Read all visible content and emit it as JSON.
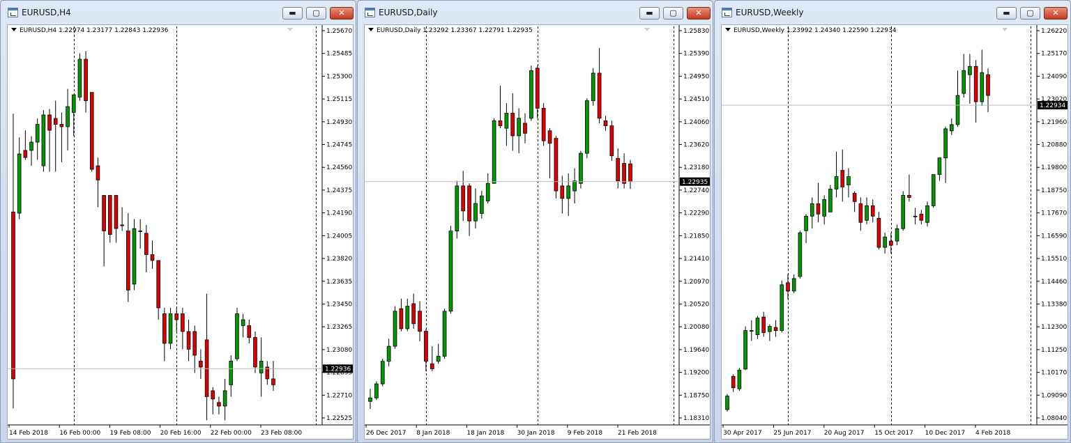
{
  "windows": [
    {
      "id": "h4",
      "title": "EURUSD,H4",
      "info": "EURUSD,H4  1.22974 1.23177 1.22843 1.22936",
      "current_price": "1.22936",
      "current_value": 1.22936,
      "y_min": 1.2252,
      "y_max": 1.2578,
      "price_ticks": [
        "1.25670",
        "1.25485",
        "1.25300",
        "1.25115",
        "1.24930",
        "1.24745",
        "1.24560",
        "1.24375",
        "1.24190",
        "1.24005",
        "1.23820",
        "1.23635",
        "1.23450",
        "1.23265",
        "1.23080",
        "1.22895",
        "1.22710",
        "1.22525"
      ],
      "date_labels": [
        "14 Feb 2018",
        "16 Feb 00:00",
        "19 Feb 08:00",
        "20 Feb 16:00",
        "22 Feb 00:00",
        "23 Feb 08:00"
      ],
      "candles": [
        [
          1.2426,
          1.2509,
          1.226,
          1.2285
        ],
        [
          1.2425,
          1.2489,
          1.242,
          1.2475
        ],
        [
          1.2478,
          1.2495,
          1.247,
          1.2472
        ],
        [
          1.2478,
          1.249,
          1.2465,
          1.2485
        ],
        [
          1.2485,
          1.2505,
          1.247,
          1.25
        ],
        [
          1.2465,
          1.2512,
          1.246,
          1.2508
        ],
        [
          1.2508,
          1.2513,
          1.246,
          1.2495
        ],
        [
          1.2505,
          1.252,
          1.246,
          1.25
        ],
        [
          1.25,
          1.251,
          1.2468,
          1.2498
        ],
        [
          1.2498,
          1.253,
          1.2478,
          1.2515
        ],
        [
          1.251,
          1.2525,
          1.249,
          1.2525
        ],
        [
          1.2523,
          1.256,
          1.252,
          1.2555
        ],
        [
          1.2555,
          1.2562,
          1.251,
          1.252
        ],
        [
          1.2527,
          1.2527,
          1.246,
          1.2462
        ],
        [
          1.2465,
          1.2472,
          1.243,
          1.2453
        ],
        [
          1.244,
          1.244,
          1.238,
          1.241
        ],
        [
          1.244,
          1.244,
          1.24,
          1.2407
        ],
        [
          1.244,
          1.244,
          1.24,
          1.2412
        ],
        [
          1.2415,
          1.243,
          1.241,
          1.2415
        ],
        [
          1.241,
          1.2425,
          1.235,
          1.236
        ],
        [
          1.2365,
          1.242,
          1.236,
          1.2412
        ],
        [
          1.241,
          1.242,
          1.2395,
          1.241
        ],
        [
          1.2408,
          1.2415,
          1.2375,
          1.239
        ],
        [
          1.239,
          1.2402,
          1.2378,
          1.2385
        ],
        [
          1.2385,
          1.2385,
          1.2335,
          1.2345
        ],
        [
          1.234,
          1.2345,
          1.23,
          1.2315
        ],
        [
          1.2315,
          1.2345,
          1.231,
          1.234
        ],
        [
          1.234,
          1.2345,
          1.2325,
          1.2335
        ],
        [
          1.234,
          1.2345,
          1.231,
          1.2325
        ],
        [
          1.2325,
          1.2335,
          1.23,
          1.231
        ],
        [
          1.2325,
          1.233,
          1.229,
          1.2305
        ],
        [
          1.23,
          1.231,
          1.2285,
          1.2295
        ],
        [
          1.2318,
          1.2357,
          1.225,
          1.227
        ],
        [
          1.2275,
          1.2278,
          1.2255,
          1.2268
        ],
        [
          1.2265,
          1.227,
          1.2255,
          1.2262
        ],
        [
          1.2262,
          1.2285,
          1.225,
          1.2275
        ],
        [
          1.228,
          1.2305,
          1.227,
          1.23
        ],
        [
          1.2302,
          1.2345,
          1.23,
          1.234
        ],
        [
          1.233,
          1.234,
          1.232,
          1.2335
        ],
        [
          1.233,
          1.2335,
          1.2315,
          1.232
        ],
        [
          1.232,
          1.2325,
          1.229,
          1.2295
        ],
        [
          1.229,
          1.232,
          1.227,
          1.23
        ],
        [
          1.2295,
          1.23,
          1.228,
          1.2285
        ],
        [
          1.2285,
          1.23,
          1.2275,
          1.228
        ]
      ]
    },
    {
      "id": "d1",
      "title": "EURUSD,Daily",
      "info": "EURUSD,Daily  1.23292 1.23367 1.22791 1.22935",
      "current_price": "1.22935",
      "current_value": 1.22935,
      "y_min": 1.1822,
      "y_max": 1.2592,
      "price_ticks": [
        "1.25830",
        "1.25390",
        "1.24950",
        "1.24510",
        "1.24060",
        "1.23620",
        "1.23180",
        "1.22740",
        "1.22290",
        "1.21850",
        "1.21410",
        "1.20970",
        "1.20520",
        "1.20080",
        "1.19640",
        "1.19200",
        "1.18750",
        "1.18310"
      ],
      "date_labels": [
        "26 Dec 2017",
        "8 Jan 2018",
        "18 Jan 2018",
        "30 Jan 2018",
        "9 Feb 2018",
        "21 Feb 2018"
      ],
      "candles": [
        [
          1.1855,
          1.188,
          1.184,
          1.1862
        ],
        [
          1.1862,
          1.1895,
          1.1858,
          1.189
        ],
        [
          1.189,
          1.194,
          1.1885,
          1.1935
        ],
        [
          1.1935,
          1.198,
          1.1925,
          1.1965
        ],
        [
          1.1965,
          1.2045,
          1.196,
          1.2035
        ],
        [
          1.204,
          1.206,
          1.1995,
          1.2
        ],
        [
          1.2,
          1.206,
          1.1995,
          1.2045
        ],
        [
          1.205,
          1.207,
          1.2,
          1.201
        ],
        [
          1.2035,
          1.2055,
          1.1975,
          1.1995
        ],
        [
          1.1995,
          1.2,
          1.1915,
          1.1935
        ],
        [
          1.193,
          1.1965,
          1.1915,
          1.192
        ],
        [
          1.1935,
          1.197,
          1.193,
          1.1945
        ],
        [
          1.1945,
          1.204,
          1.194,
          1.2035
        ],
        [
          1.2035,
          1.2205,
          1.203,
          1.2195
        ],
        [
          1.2195,
          1.2295,
          1.218,
          1.2285
        ],
        [
          1.2285,
          1.2315,
          1.2215,
          1.2235
        ],
        [
          1.2285,
          1.229,
          1.2185,
          1.2215
        ],
        [
          1.2215,
          1.228,
          1.22,
          1.225
        ],
        [
          1.223,
          1.2275,
          1.222,
          1.2265
        ],
        [
          1.2255,
          1.231,
          1.225,
          1.229
        ],
        [
          1.229,
          1.242,
          1.229,
          1.2415
        ],
        [
          1.2415,
          1.2485,
          1.24,
          1.2405
        ],
        [
          1.24,
          1.245,
          1.2365,
          1.243
        ],
        [
          1.243,
          1.247,
          1.2355,
          1.2385
        ],
        [
          1.2385,
          1.244,
          1.235,
          1.242
        ],
        [
          1.241,
          1.243,
          1.237,
          1.239
        ],
        [
          1.242,
          1.2525,
          1.2415,
          1.2515
        ],
        [
          1.252,
          1.2525,
          1.242,
          1.244
        ],
        [
          1.244,
          1.245,
          1.2365,
          1.2375
        ],
        [
          1.2395,
          1.24,
          1.23,
          1.237
        ],
        [
          1.238,
          1.2385,
          1.226,
          1.2275
        ],
        [
          1.2285,
          1.2305,
          1.223,
          1.226
        ],
        [
          1.226,
          1.231,
          1.2225,
          1.2285
        ],
        [
          1.2275,
          1.232,
          1.225,
          1.2295
        ],
        [
          1.229,
          1.2355,
          1.228,
          1.235
        ],
        [
          1.235,
          1.246,
          1.234,
          1.2455
        ],
        [
          1.2455,
          1.252,
          1.2445,
          1.251
        ],
        [
          1.251,
          1.256,
          1.241,
          1.242
        ],
        [
          1.2415,
          1.2425,
          1.2395,
          1.2405
        ],
        [
          1.2405,
          1.2415,
          1.2335,
          1.2345
        ],
        [
          1.234,
          1.236,
          1.228,
          1.2295
        ],
        [
          1.233,
          1.235,
          1.228,
          1.229
        ],
        [
          1.2329,
          1.2337,
          1.2279,
          1.2294
        ]
      ]
    },
    {
      "id": "w1",
      "title": "EURUSD,Weekly",
      "info": "EURUSD,Weekly  1.23992 1.24340 1.22590 1.22934",
      "current_price": "1.22934",
      "current_value": 1.22934,
      "y_min": 1.079,
      "y_max": 1.2645,
      "price_ticks": [
        "1.26220",
        "1.25170",
        "1.24090",
        "1.23020",
        "1.21960",
        "1.20880",
        "1.19800",
        "1.18750",
        "1.17670",
        "1.16590",
        "1.15510",
        "1.14460",
        "1.13380",
        "1.12300",
        "1.11250",
        "1.10170",
        "1.09090",
        "1.08040"
      ],
      "date_labels": [
        "30 Apr 2017",
        "25 Jun 2017",
        "20 Aug 2017",
        "15 Oct 2017",
        "10 Dec 2017",
        "4 Feb 2018"
      ],
      "candles": [
        [
          1.083,
          1.0905,
          1.082,
          1.0895
        ],
        [
          1.099,
          1.1,
          1.0915,
          1.0935
        ],
        [
          1.093,
          1.103,
          1.092,
          1.102
        ],
        [
          1.1025,
          1.123,
          1.102,
          1.121
        ],
        [
          1.121,
          1.126,
          1.116,
          1.121
        ],
        [
          1.119,
          1.128,
          1.117,
          1.127
        ],
        [
          1.1275,
          1.13,
          1.118,
          1.12
        ],
        [
          1.1205,
          1.124,
          1.116,
          1.123
        ],
        [
          1.1225,
          1.126,
          1.118,
          1.121
        ],
        [
          1.121,
          1.145,
          1.12,
          1.143
        ],
        [
          1.144,
          1.148,
          1.136,
          1.14
        ],
        [
          1.14,
          1.148,
          1.139,
          1.146
        ],
        [
          1.147,
          1.169,
          1.146,
          1.168
        ],
        [
          1.169,
          1.177,
          1.163,
          1.176
        ],
        [
          1.176,
          1.185,
          1.17,
          1.182
        ],
        [
          1.182,
          1.192,
          1.173,
          1.177
        ],
        [
          1.176,
          1.186,
          1.172,
          1.184
        ],
        [
          1.178,
          1.191,
          1.178,
          1.189
        ],
        [
          1.189,
          1.207,
          1.185,
          1.195
        ],
        [
          1.198,
          1.208,
          1.183,
          1.19
        ],
        [
          1.191,
          1.199,
          1.185,
          1.195
        ],
        [
          1.187,
          1.188,
          1.178,
          1.183
        ],
        [
          1.182,
          1.185,
          1.169,
          1.173
        ],
        [
          1.174,
          1.185,
          1.172,
          1.181
        ],
        [
          1.181,
          1.184,
          1.173,
          1.176
        ],
        [
          1.175,
          1.178,
          1.16,
          1.161
        ],
        [
          1.161,
          1.168,
          1.158,
          1.166
        ],
        [
          1.164,
          1.168,
          1.158,
          1.162
        ],
        [
          1.164,
          1.172,
          1.162,
          1.17
        ],
        [
          1.17,
          1.188,
          1.169,
          1.186
        ],
        [
          1.186,
          1.196,
          1.183,
          1.185
        ],
        [
          1.176,
          1.18,
          1.172,
          1.176
        ],
        [
          1.177,
          1.179,
          1.172,
          1.174
        ],
        [
          1.173,
          1.183,
          1.171,
          1.181
        ],
        [
          1.181,
          1.196,
          1.18,
          1.196
        ],
        [
          1.196,
          1.204,
          1.193,
          1.204
        ],
        [
          1.204,
          1.219,
          1.192,
          1.218
        ],
        [
          1.217,
          1.223,
          1.215,
          1.22
        ],
        [
          1.22,
          1.246,
          1.219,
          1.234
        ],
        [
          1.235,
          1.254,
          1.233,
          1.246
        ],
        [
          1.244,
          1.254,
          1.23,
          1.248
        ],
        [
          1.248,
          1.251,
          1.221,
          1.231
        ],
        [
          1.231,
          1.256,
          1.229,
          1.245
        ],
        [
          1.244,
          1.247,
          1.226,
          1.234
        ]
      ]
    }
  ],
  "colors": {
    "bull": "#009a00",
    "bear": "#dd0000",
    "outline": "#000000",
    "price_tag_bg": "#000000",
    "price_tag_fg": "#ffffff"
  },
  "buttons": {
    "minimize": "▬",
    "maximize": "▢",
    "close": "✕"
  }
}
